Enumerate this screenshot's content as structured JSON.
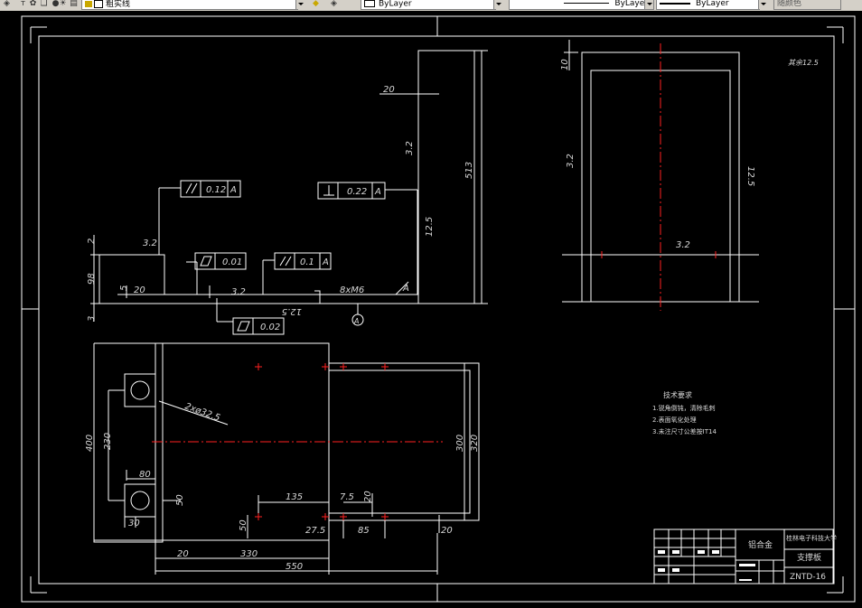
{
  "toolbar": {
    "layer_name": "粗实线",
    "color_value": "ByLayer",
    "linetype_value": "ByLayer",
    "lineweight_value": "ByLayer",
    "plotstyle_value": "随颜色"
  },
  "drawing": {
    "dims_front": {
      "d20_top": "20",
      "d513": "513",
      "d2": "2",
      "d98": "98",
      "d5": "5",
      "d20_left": "20",
      "d3": "3",
      "thread": "8xM6",
      "d400": "400",
      "d230": "230",
      "d80": "80",
      "d50_right": "50",
      "d30": "30",
      "d20_bottom": "20",
      "d330": "330",
      "d550": "550",
      "d135": "135",
      "d7_5": "7.5",
      "d20_v": "20",
      "d50_v": "50",
      "d27_5": "27.5",
      "d85": "85",
      "d20_r": "20",
      "d300": "300",
      "d320": "320",
      "d10": "10",
      "hole_callout": "2xø32.5"
    },
    "roughness": {
      "r1": "3.2",
      "r2": "3.2",
      "r3": "3.2",
      "r4": "12.5",
      "r5": "12.5",
      "r6": "3.2",
      "r7": "12.5",
      "r8": "3.2",
      "r9": "12.5",
      "corner_note": "其余12.5"
    },
    "tolerances": {
      "t1_value": "0.12",
      "t1_ref": "A",
      "t2_value": "0.22",
      "t2_ref": "A",
      "t3_value": "0.01",
      "t4_value": "0.1",
      "t4_ref": "A",
      "t5_value": "0.02",
      "datum": "A"
    },
    "tech_req": {
      "title": "技术要求",
      "items": [
        "1.锐角倒钝，清除毛刺",
        "2.表面氧化处理",
        "3.未注尺寸公差按IT14"
      ]
    },
    "title_block": {
      "material": "铝合金",
      "school": "桂林电子科技大学",
      "part_name": "支撑板",
      "drawing_no": "ZNTD-16"
    }
  },
  "colors": {
    "background": "#000000",
    "line": "#ffffff",
    "center_line": "#ff0000",
    "dim_text": "#d8d8d8"
  }
}
